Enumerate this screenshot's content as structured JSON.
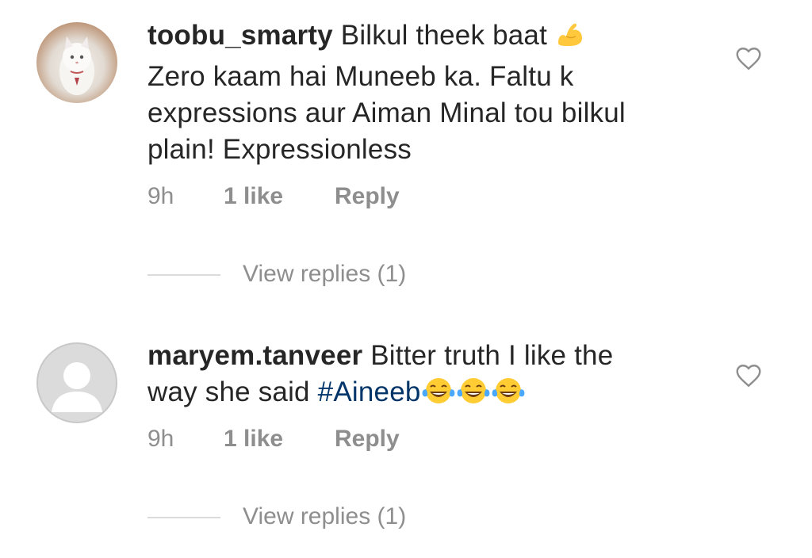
{
  "comments": [
    {
      "username": "toobu_smarty",
      "text_line1": "Bilkul theek baat",
      "emoji_icon": "flexed-biceps-icon",
      "text_rest": [
        "Zero kaam hai Muneeb ka. Faltu k",
        "expressions aur Aiman Minal tou bilkul",
        "plain! Expressionless"
      ],
      "time": "9h",
      "likes": "1 like",
      "reply_label": "Reply",
      "view_replies": "View replies (1)",
      "avatar_icon": "kitten-avatar-icon",
      "heart_icon": "heart-outline-icon"
    },
    {
      "username": "maryem.tanveer",
      "text_line1": "Bitter truth I like the",
      "text_line2_prefix": "way she said",
      "hashtag": "#Aineeb",
      "emoji_icon": "face-with-tears-of-joy-icon",
      "time": "9h",
      "likes": "1 like",
      "reply_label": "Reply",
      "view_replies": "View replies (1)",
      "avatar_icon": "default-avatar-icon",
      "heart_icon": "heart-outline-icon"
    }
  ],
  "colors": {
    "text": "#262626",
    "secondary": "#8e8e8e",
    "hashtag": "#003569",
    "divider": "#dbdbdb"
  }
}
